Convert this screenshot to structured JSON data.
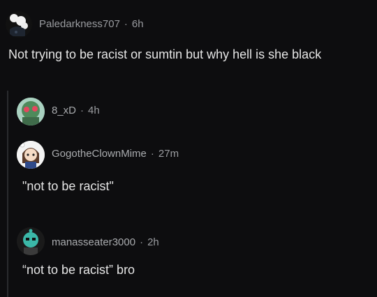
{
  "comments": [
    {
      "username": "Paledarkness707",
      "time": "6h",
      "text": "Not trying to be racist or sumtin but why hell is she black"
    },
    {
      "username": "8_xD",
      "time": "4h",
      "text": ""
    },
    {
      "username": "GogotheClownMime",
      "time": "27m",
      "text": "\"not to be racist\""
    },
    {
      "username": "manasseater3000",
      "time": "2h",
      "text": "“not to be racist” bro"
    }
  ],
  "colors": {
    "background": "#0d0d0f",
    "meta": "#9a9ca0",
    "text": "#e6e6e6",
    "thread": "#2a2b2e"
  }
}
